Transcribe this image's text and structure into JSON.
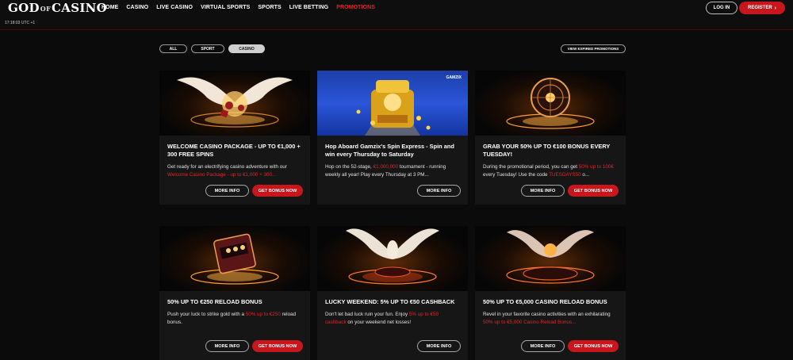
{
  "header": {
    "logo_main": "GOD",
    "logo_of": "OF",
    "logo_tail": "CASINO",
    "nav": [
      "HOME",
      "CASINO",
      "LIVE CASINO",
      "VIRTUAL SPORTS",
      "SPORTS",
      "LIVE BETTING",
      "PROMOTIONS"
    ],
    "active_nav": "PROMOTIONS",
    "time": "17:18:03 UTC +1",
    "login_label": "LOG IN",
    "register_label": "REGISTER",
    "register_icon": "chevron-right-icon"
  },
  "filters": {
    "all": "ALL",
    "sport": "SPORT",
    "casino": "CASINO",
    "selected": "CASINO",
    "expired_label": "VIEW EXPIRED PROMOTIONS"
  },
  "colors": {
    "accent": "#c8161d",
    "background": "#0b0b0b",
    "card": "#161616"
  },
  "cards": [
    {
      "title": "WELCOME CASINO PACKAGE - UP TO €1,000 + 300 FREE SPINS",
      "desc_pre": "Get ready for an electrifying casino adventure with our ",
      "desc_hl": "Welcome Casino Package - up to €1,000 + 300...",
      "desc_post": "",
      "more": "MORE INFO",
      "bonus": "GET BONUS NOW",
      "has_bonus": true,
      "image": "winged-casino-chips-image"
    },
    {
      "title": "Hop Aboard Gamzix's Spin Express - Spin and win every Thursday to Saturday",
      "desc_pre": "Hop on the 52-stage, ",
      "desc_hl": "€1,000,000",
      "desc_post": " tournament - running weekly all year! Play every Thursday at 3 PM...",
      "more": "MORE INFO",
      "bonus": "",
      "has_bonus": false,
      "image": "gamzix-train-image",
      "brand": "GAMZIX"
    },
    {
      "title": "GRAB YOUR 50% UP TO €100 BONUS EVERY TUESDAY!",
      "desc_pre": "During the promotional period, you can get ",
      "desc_hl": "50% up to 100€",
      "desc_post": " every Tuesday! Use the code ",
      "desc_hl2": "TUESDAYS50",
      "desc_post2": " o...",
      "more": "MORE INFO",
      "bonus": "GET BONUS NOW",
      "has_bonus": true,
      "image": "roulette-wheel-image"
    },
    {
      "title": "50% UP TO €250 RELOAD BONUS",
      "desc_pre": "Push your luck to strike gold with a ",
      "desc_hl": "50% up to €250",
      "desc_post": " reload bonus.",
      "more": "MORE INFO",
      "bonus": "GET BONUS NOW",
      "has_bonus": true,
      "image": "slot-machine-image"
    },
    {
      "title": "LUCKY WEEKEND: 5% UP TO €50 CASHBACK",
      "desc_pre": "Don't let bad luck ruin your fun. Enjoy ",
      "desc_hl": "5% up to €50 cashback",
      "desc_post": " on your weekend net losses!",
      "more": "MORE INFO",
      "bonus": "",
      "has_bonus": false,
      "image": "winged-roulette-image"
    },
    {
      "title": "50% UP TO €5,000 CASINO RELOAD BONUS",
      "desc_pre": "Revel in your favorite casino activities with an exhilarating ",
      "desc_hl": "50% up to €5,000 Casino Reload Bonus...",
      "desc_post": "",
      "more": "MORE INFO",
      "bonus": "GET BONUS NOW",
      "has_bonus": true,
      "image": "phoenix-roulette-image"
    }
  ]
}
